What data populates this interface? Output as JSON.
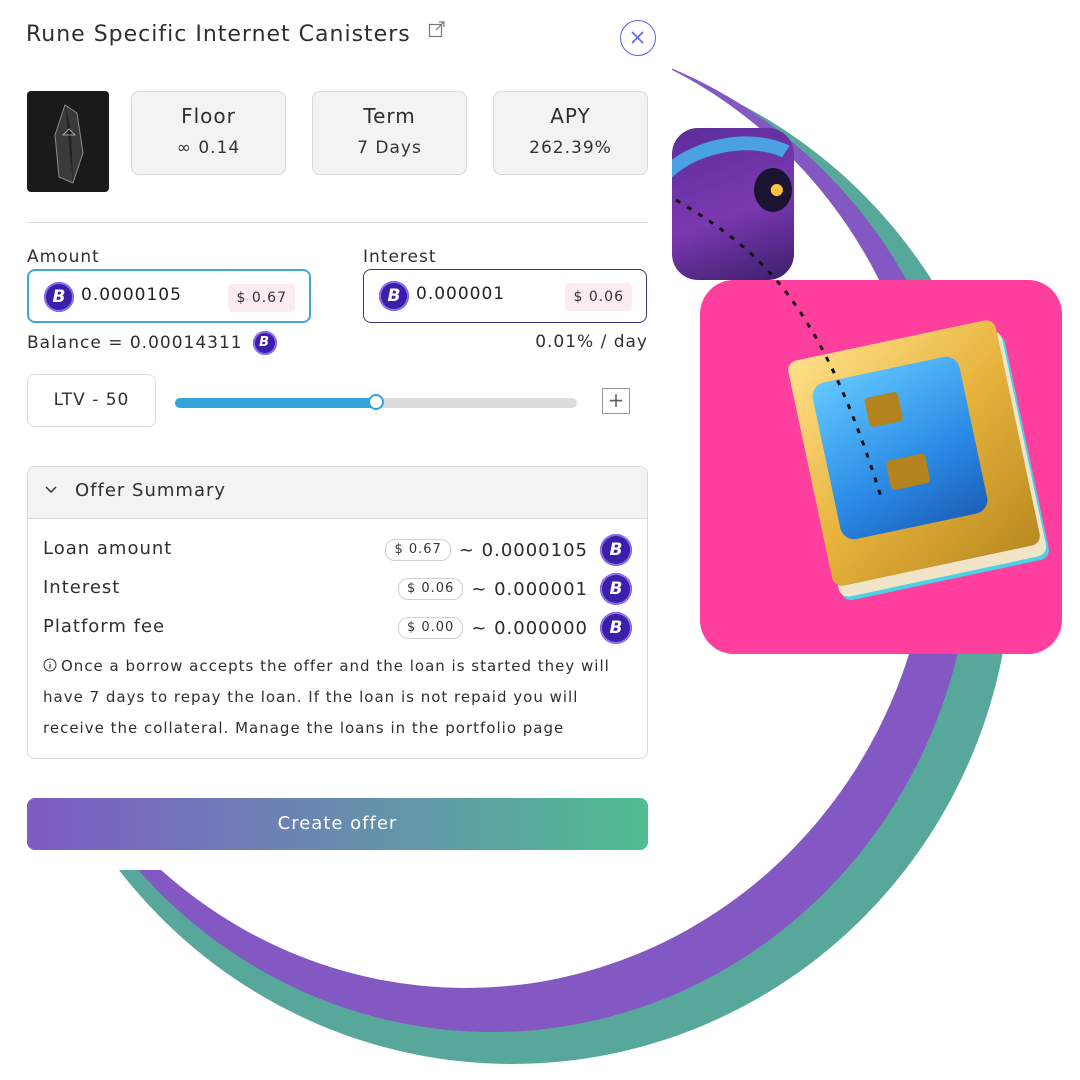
{
  "modal": {
    "title": "Rune Specific Internet Canisters",
    "stats": {
      "floor_label": "Floor",
      "floor_value": "∞ 0.14",
      "term_label": "Term",
      "term_value": "7 Days",
      "apy_label": "APY",
      "apy_value": "262.39%"
    },
    "amount": {
      "label": "Amount",
      "value": "0.0000105",
      "usd": "$ 0.67"
    },
    "interest": {
      "label": "Interest",
      "value": "0.000001",
      "usd": "$ 0.06"
    },
    "balance": "Balance =  0.00014311",
    "per_day": "0.01% / day",
    "ltv": {
      "label": "LTV - 50",
      "value_percent": 50,
      "plus": "+"
    },
    "summary": {
      "title": "Offer Summary",
      "rows": [
        {
          "label": "Loan amount",
          "usd": "$ 0.67",
          "btc": "~ 0.0000105"
        },
        {
          "label": "Interest",
          "usd": "$ 0.06",
          "btc": "~ 0.000001"
        },
        {
          "label": "Platform fee",
          "usd": "$ 0.00",
          "btc": "~ 0.000000"
        }
      ],
      "note": "Once a borrow accepts the offer and the loan is started they will have 7 days to repay the loan. If the loan is not repaid you will receive the collateral. Manage the loans in the portfolio page"
    },
    "create_button": "Create offer"
  },
  "icons": {
    "btc": "bitcoin-icon",
    "external": "external-link-icon",
    "close": "close-icon",
    "chevron": "chevron-down-icon",
    "info": "info-icon"
  },
  "colors": {
    "accent_blue": "#3da6dd",
    "btc_purple": "#3b1fa8",
    "ring_purple": "#8358c2",
    "ring_green": "#57a89a",
    "pink_card": "#ff3f9d"
  }
}
